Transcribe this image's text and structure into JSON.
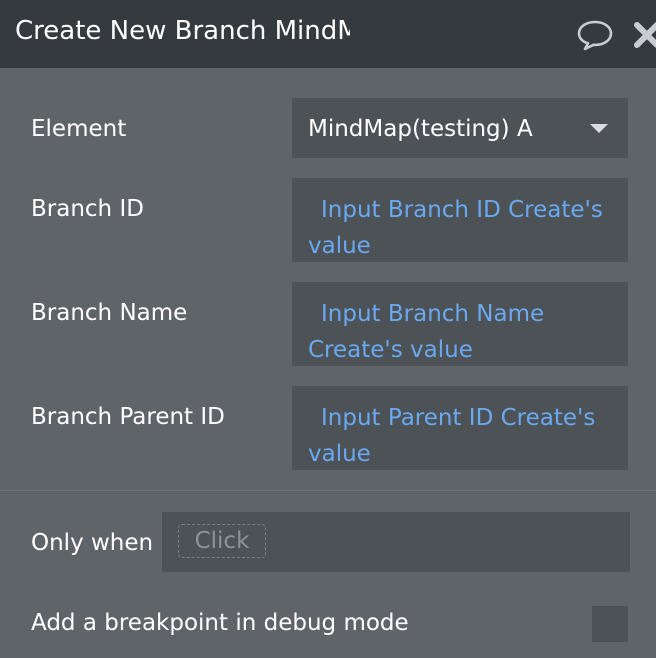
{
  "header": {
    "title": "Create New Branch MindMap(testing) A",
    "comment_icon": "speech-bubble-icon",
    "close_icon": "close-x-icon"
  },
  "fields": {
    "element": {
      "label": "Element",
      "value": "MindMap(testing) A"
    },
    "branch_id": {
      "label": "Branch ID",
      "value": "Input Branch ID Create's value"
    },
    "branch_name": {
      "label": "Branch Name",
      "value": "Input Branch Name Create's value"
    },
    "branch_parent_id": {
      "label": "Branch Parent ID",
      "value": "Input Parent ID Create's value"
    }
  },
  "conditions": {
    "only_when_label": "Only when",
    "only_when_placeholder": "Click",
    "breakpoint_label": "Add a breakpoint in debug mode",
    "breakpoint_checked": false
  },
  "colors": {
    "panel_bg": "#5f6469",
    "header_bg": "#353a3f",
    "field_bg": "#4d5257",
    "expression_text": "#6aa9f0"
  }
}
